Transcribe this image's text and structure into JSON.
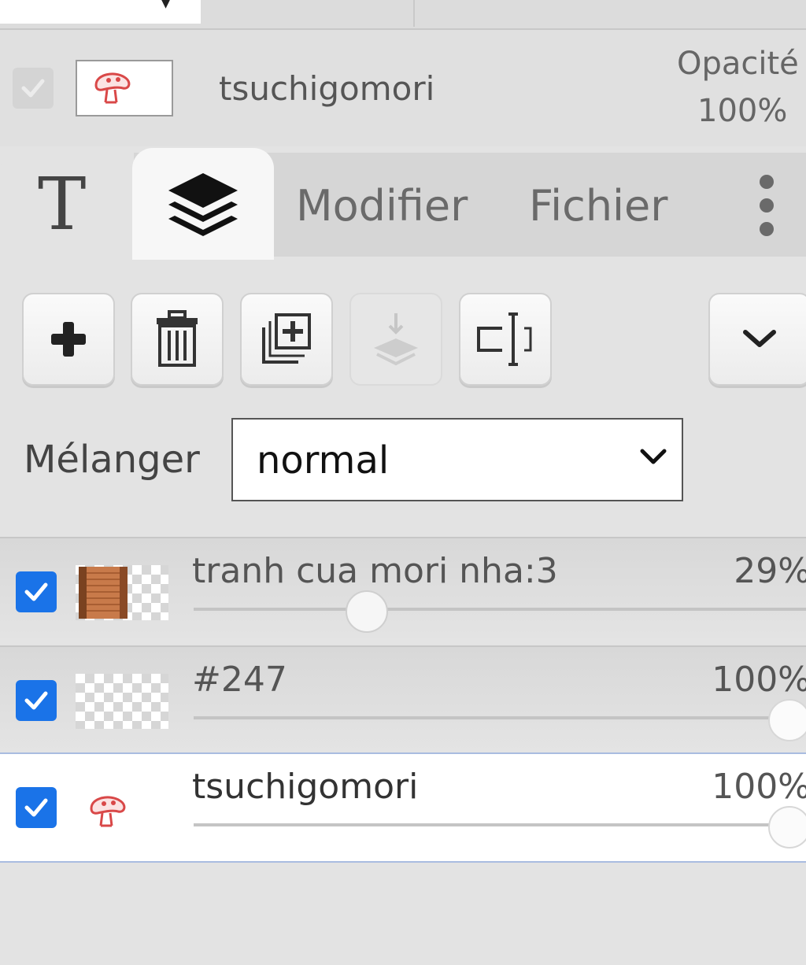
{
  "layer_header": {
    "name": "tsuchigomori",
    "opacity_label": "Opacité",
    "opacity_value": "100%"
  },
  "tabs": [
    {
      "name": "text-tab",
      "label": "T"
    },
    {
      "name": "layers-tab",
      "icon": "layers-icon"
    },
    {
      "name": "modifier-tab",
      "label": "Modifier"
    },
    {
      "name": "fichier-tab",
      "label": "Fichier"
    }
  ],
  "toolbar": {
    "buttons": [
      {
        "name": "add-layer-button",
        "icon": "plus-icon",
        "enabled": true
      },
      {
        "name": "delete-layer-button",
        "icon": "trash-icon",
        "enabled": true
      },
      {
        "name": "duplicate-layer-button",
        "icon": "duplicate-icon",
        "enabled": true
      },
      {
        "name": "merge-down-button",
        "icon": "merge-down-icon",
        "enabled": false
      },
      {
        "name": "rename-layer-button",
        "icon": "rename-icon",
        "enabled": true
      },
      {
        "name": "expand-button",
        "icon": "chevron-down-icon",
        "enabled": true
      }
    ]
  },
  "blend": {
    "label": "Mélanger",
    "value": "normal"
  },
  "layers": [
    {
      "name": "tranh cua mori nha:3",
      "opacity_text": "29%",
      "opacity": 0.29,
      "visible": true,
      "selected": false
    },
    {
      "name": "#247",
      "opacity_text": "100%",
      "opacity": 1.0,
      "visible": true,
      "selected": false
    },
    {
      "name": "tsuchigomori",
      "opacity_text": "100%",
      "opacity": 1.0,
      "visible": true,
      "selected": true
    }
  ],
  "colors": {
    "accent": "#1a73e8",
    "selection_border": "#a9bce0",
    "panel_bg": "#e3e3e3"
  }
}
